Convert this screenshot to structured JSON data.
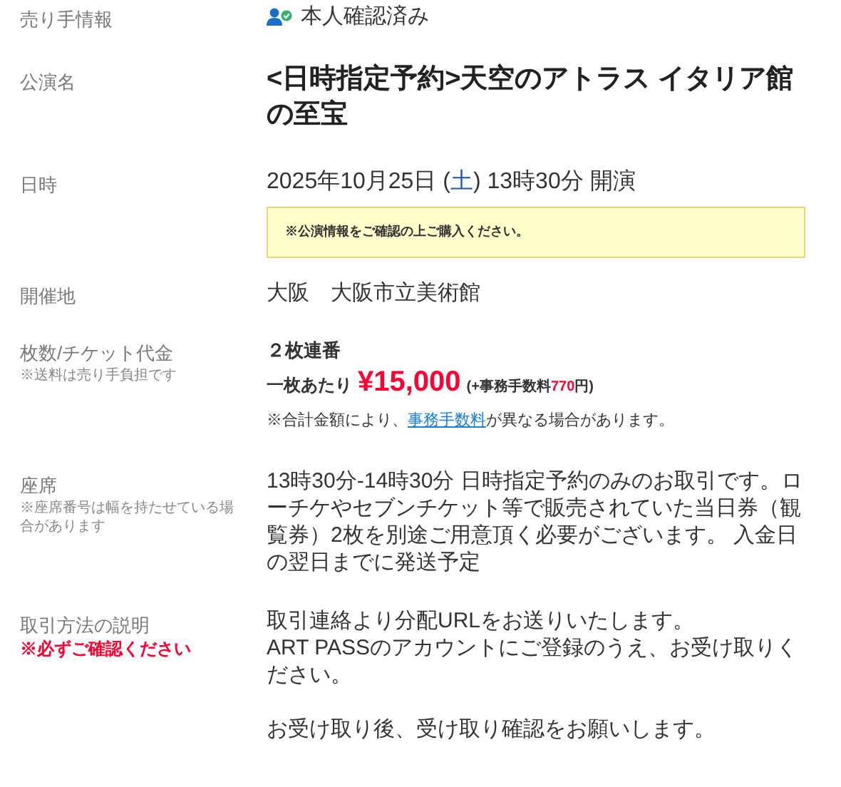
{
  "rows": [
    {
      "kind": "seller",
      "label": "売り手情報",
      "verified": true,
      "value": "本人確認済み"
    },
    {
      "kind": "title",
      "label": "公演名",
      "value": "<日時指定予約>天空のアトラス イタリア館の至宝"
    },
    {
      "kind": "date",
      "label": "日時",
      "date_before": "2025年10月25日 (",
      "weekday": "土",
      "date_after": ") 13時30分 開演",
      "notice": "※公演情報をご確認の上ご購入ください。"
    },
    {
      "kind": "text",
      "label": "開催地",
      "value": "大阪　大阪市立美術館"
    },
    {
      "kind": "price",
      "label": "枚数/チケット代金",
      "sublabel": "※送料は売り手負担です",
      "quantity": "２枚連番",
      "per_label": "一枚あたり",
      "price": "¥15,000",
      "fee_before": "(+事務手数料",
      "fee": "770",
      "fee_after": "円)",
      "note_before": "※合計金額により、",
      "note_link": "事務手数料",
      "note_after": "が異なる場合があります。"
    },
    {
      "kind": "paragraphs",
      "label": "座席",
      "sublabel": "※座席番号は幅を持たせている場合があります",
      "paragraphs": [
        "13時30分-14時30分 日時指定予約のみのお取引です。ローチケやセブンチケット等で販売されていた当日券（観覧券）2枚を別途ご用意頂く必要がございます。 入金日の翌日までに発送予定"
      ]
    },
    {
      "kind": "paragraphs",
      "label": "取引方法の説明",
      "warning": "※必ずご確認ください",
      "paragraphs": [
        "取引連絡より分配URLをお送りいたします。\nART PASSのアカウントにご登録のうえ、お受け取りください。",
        "お受け取り後、受け取り確認をお願いします。"
      ]
    }
  ]
}
